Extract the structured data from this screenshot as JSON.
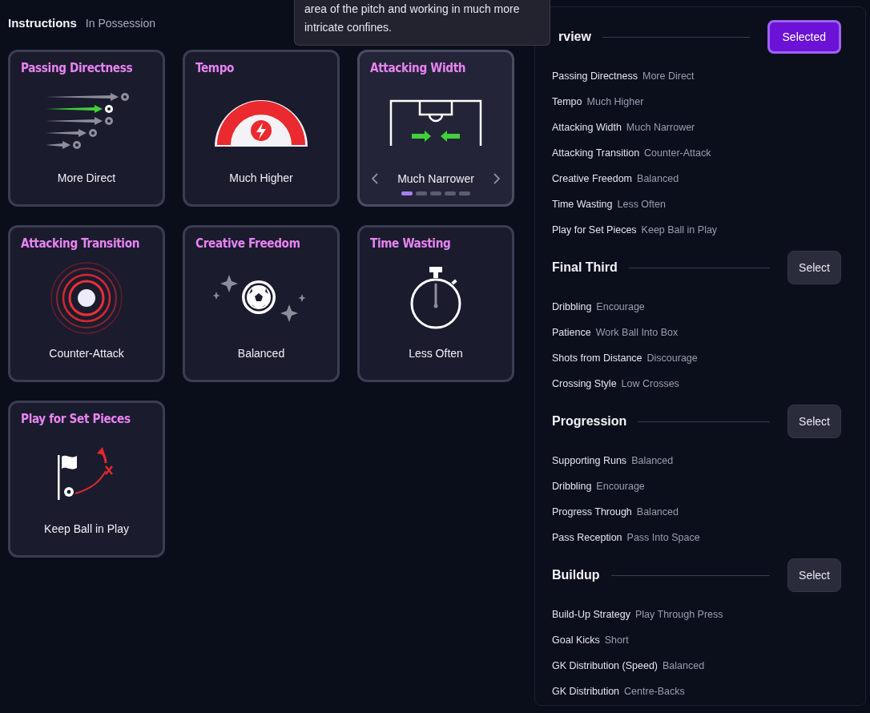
{
  "header": {
    "title": "Instructions",
    "subtitle": "In Possession"
  },
  "tooltip": {
    "text": "area of the pitch and working in much more intricate confines."
  },
  "cards": [
    {
      "title": "Passing Directness",
      "value": "More Direct",
      "kind": "directness",
      "hovered": false
    },
    {
      "title": "Tempo",
      "value": "Much Higher",
      "kind": "tempo",
      "hovered": false
    },
    {
      "title": "Attacking Width",
      "value": "Much Narrower",
      "kind": "width",
      "hovered": true,
      "pages": [
        {
          "selected": true
        },
        {
          "selected": false
        },
        {
          "selected": false
        },
        {
          "selected": false
        },
        {
          "selected": false
        }
      ]
    },
    {
      "title": "Attacking Transition",
      "value": "Counter-Attack",
      "kind": "transition",
      "hovered": false
    },
    {
      "title": "Creative Freedom",
      "value": "Balanced",
      "kind": "freedom",
      "hovered": false
    },
    {
      "title": "Time Wasting",
      "value": "Less Often",
      "kind": "time",
      "hovered": false
    },
    {
      "title": "Play for Set Pieces",
      "value": "Keep Ball in Play",
      "kind": "setpieces",
      "hovered": false
    }
  ],
  "sections": [
    {
      "title": "rview",
      "button": "Selected",
      "selected": true,
      "rows": [
        {
          "label": "Passing Directness",
          "value": "More Direct"
        },
        {
          "label": "Tempo",
          "value": "Much Higher"
        },
        {
          "label": "Attacking Width",
          "value": "Much Narrower"
        },
        {
          "label": "Attacking Transition",
          "value": "Counter-Attack"
        },
        {
          "label": "Creative Freedom",
          "value": "Balanced"
        },
        {
          "label": "Time Wasting",
          "value": "Less Often"
        },
        {
          "label": "Play for Set Pieces",
          "value": "Keep Ball in Play"
        }
      ]
    },
    {
      "title": "Final Third",
      "button": "Select",
      "selected": false,
      "rows": [
        {
          "label": "Dribbling",
          "value": "Encourage"
        },
        {
          "label": "Patience",
          "value": "Work Ball Into Box"
        },
        {
          "label": "Shots from Distance",
          "value": "Discourage"
        },
        {
          "label": "Crossing Style",
          "value": "Low Crosses"
        }
      ]
    },
    {
      "title": "Progression",
      "button": "Select",
      "selected": false,
      "rows": [
        {
          "label": "Supporting Runs",
          "value": "Balanced"
        },
        {
          "label": "Dribbling",
          "value": "Encourage"
        },
        {
          "label": "Progress Through",
          "value": "Balanced"
        },
        {
          "label": "Pass Reception",
          "value": "Pass Into Space"
        }
      ]
    },
    {
      "title": "Buildup",
      "button": "Select",
      "selected": false,
      "rows": [
        {
          "label": "Build-Up Strategy",
          "value": "Play Through Press"
        },
        {
          "label": "Goal Kicks",
          "value": "Short"
        },
        {
          "label": "GK Distribution (Speed)",
          "value": "Balanced"
        },
        {
          "label": "GK Distribution",
          "value": "Centre-Backs"
        }
      ]
    }
  ]
}
